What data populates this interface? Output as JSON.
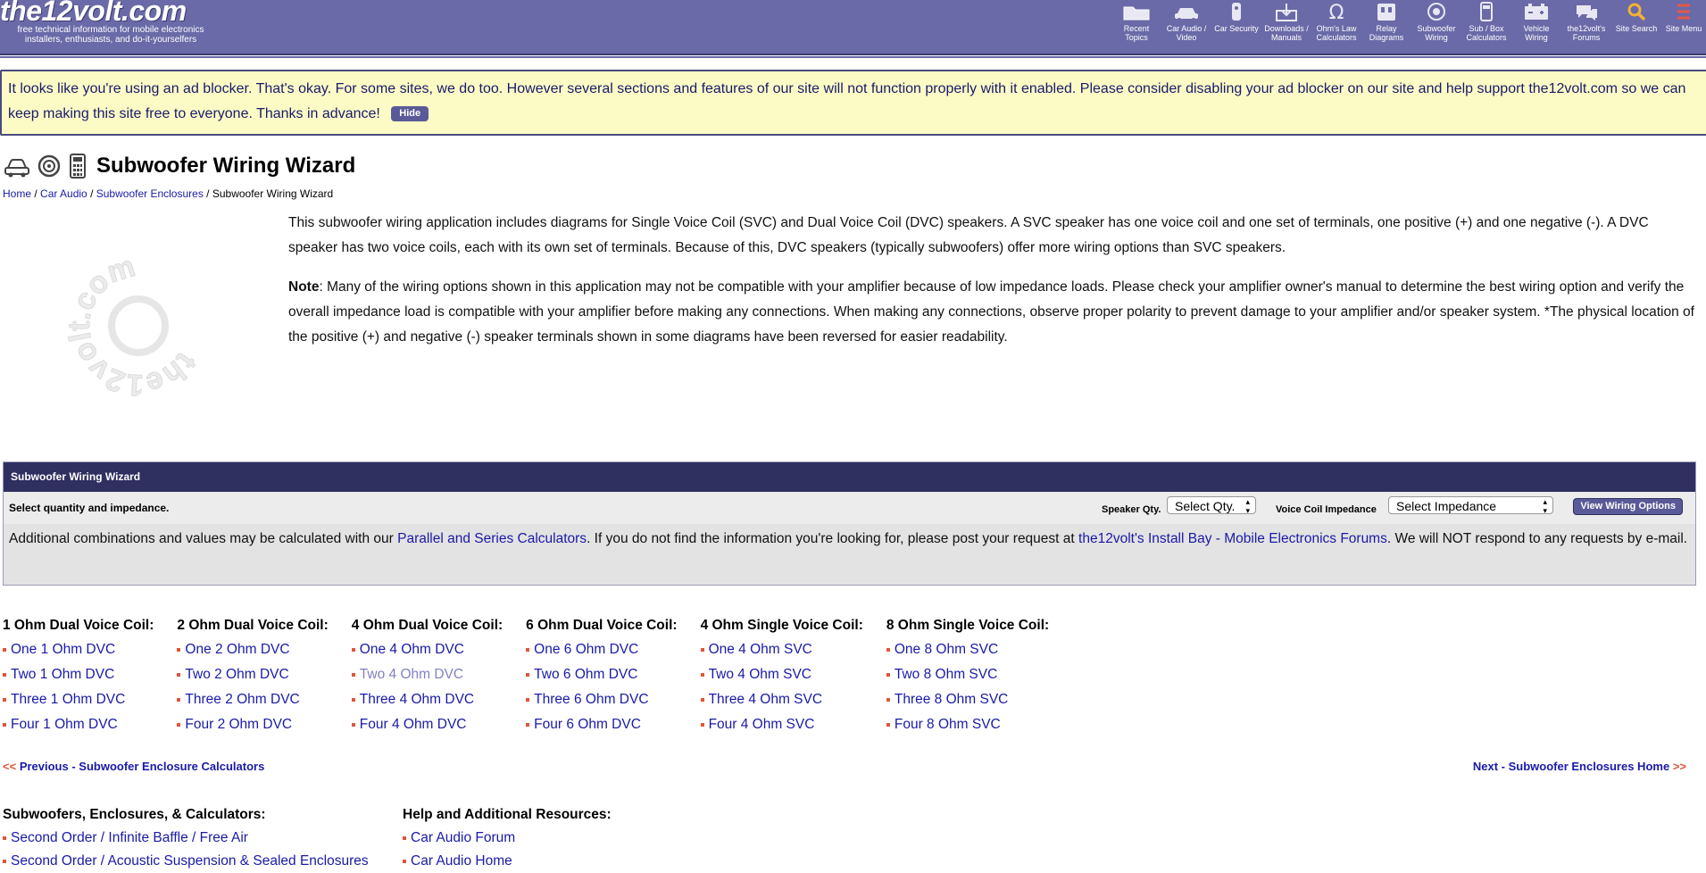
{
  "header": {
    "logo": "the12volt.com",
    "tagline": "free technical information for mobile electronics installers, enthusiasts, and do-it-yourselfers",
    "nav": [
      {
        "label": "Recent Topics",
        "icon": "folder-icon"
      },
      {
        "label": "Car Audio / Video",
        "icon": "car-icon"
      },
      {
        "label": "Car Security",
        "icon": "remote-icon"
      },
      {
        "label": "Downloads / Manuals",
        "icon": "download-icon"
      },
      {
        "label": "Ohm's Law Calculators",
        "icon": "omega-icon"
      },
      {
        "label": "Relay Diagrams",
        "icon": "relay-icon"
      },
      {
        "label": "Subwoofer Wiring",
        "icon": "speaker-icon"
      },
      {
        "label": "Sub / Box Calculators",
        "icon": "calculator-icon"
      },
      {
        "label": "Vehicle Wiring",
        "icon": "battery-icon"
      },
      {
        "label": "the12volt's Forums",
        "icon": "forum-icon"
      },
      {
        "label": "Site Search",
        "icon": "search-icon"
      },
      {
        "label": "Site Menu",
        "icon": "hamburger-icon"
      }
    ]
  },
  "notice": {
    "text": "It looks like you're using an ad blocker. That's okay. For some sites, we do too. However several sections and features of our site will not function properly with it enabled. Please consider disabling your ad blocker on our site and help support the12volt.com so we can keep making this site free to everyone. Thanks in advance!",
    "hide_label": "Hide"
  },
  "page": {
    "title": "Subwoofer Wiring Wizard",
    "breadcrumb": [
      {
        "label": "Home",
        "link": true
      },
      {
        "label": "Car Audio",
        "link": true
      },
      {
        "label": "Subwoofer Enclosures",
        "link": true
      },
      {
        "label": "Subwoofer Wiring Wizard",
        "link": false
      }
    ],
    "watermark_text": "the12volt.com",
    "intro_p1": "This subwoofer wiring application includes diagrams for Single Voice Coil (SVC) and Dual Voice Coil (DVC) speakers. A SVC speaker has one voice coil and one set of terminals, one positive (+) and one negative (-). A DVC speaker has two voice coils, each with its own set of terminals. Because of this, DVC speakers (typically subwoofers) offer more wiring options than SVC speakers.",
    "intro_note_label": "Note",
    "intro_p2": ": Many of the wiring options shown in this application may not be compatible with your amplifier because of low impedance loads. Please check your amplifier owner's manual to determine the best wiring option and verify the overall impedance load is compatible with your amplifier before making any connections. When making any connections, observe proper polarity to prevent damage to your amplifier and/or speaker system. *The physical location of the positive (+) and negative (-) speaker terminals shown in some diagrams have been reversed for easier readability."
  },
  "wizard": {
    "title": "Subwoofer Wiring Wizard",
    "prompt": "Select quantity and impedance.",
    "qty_label": "Speaker Qty.",
    "qty_value": "Select Qty.",
    "impedance_label": "Voice Coil Impedance",
    "impedance_value": "Select Impedance",
    "button_label": "View Wiring Options",
    "note_before": "Additional combinations and values may be calculated with our ",
    "note_link1": "Parallel and Series Calculators",
    "note_middle": ". If you do not find the information you're looking for, please post your request at ",
    "note_link2": "the12volt's Install Bay - Mobile Electronics Forums",
    "note_after": ". We will NOT respond to any requests by e-mail."
  },
  "coils": [
    {
      "heading": "1 Ohm Dual Voice Coil:",
      "items": [
        "One 1 Ohm DVC",
        "Two 1 Ohm DVC",
        "Three 1 Ohm DVC",
        "Four 1 Ohm DVC"
      ]
    },
    {
      "heading": "2 Ohm Dual Voice Coil:",
      "items": [
        "One 2 Ohm DVC",
        "Two 2 Ohm DVC",
        "Three 2 Ohm DVC",
        "Four 2 Ohm DVC"
      ]
    },
    {
      "heading": "4 Ohm Dual Voice Coil:",
      "items": [
        "One 4 Ohm DVC",
        "Two 4 Ohm DVC",
        "Three 4 Ohm DVC",
        "Four 4 Ohm DVC"
      ]
    },
    {
      "heading": "6 Ohm Dual Voice Coil:",
      "items": [
        "One 6 Ohm DVC",
        "Two 6 Ohm DVC",
        "Three 6 Ohm DVC",
        "Four 6 Ohm DVC"
      ]
    },
    {
      "heading": "4 Ohm Single Voice Coil:",
      "items": [
        "One 4 Ohm SVC",
        "Two 4 Ohm SVC",
        "Three 4 Ohm SVC",
        "Four 4 Ohm SVC"
      ]
    },
    {
      "heading": "8 Ohm Single Voice Coil:",
      "items": [
        "One 8 Ohm SVC",
        "Two 8 Ohm SVC",
        "Three 8 Ohm SVC",
        "Four 8 Ohm SVC"
      ]
    }
  ],
  "prevnext": {
    "prev_arrow": "<<",
    "prev_label": "Previous - Subwoofer Enclosure Calculators",
    "next_label": "Next - Subwoofer Enclosures Home",
    "next_arrow": ">>"
  },
  "resources": {
    "left_heading": "Subwoofers, Enclosures, & Calculators:",
    "left_items": [
      "Second Order / Infinite Baffle / Free Air",
      "Second Order / Acoustic Suspension & Sealed Enclosures"
    ],
    "right_heading": "Help and Additional Resources:",
    "right_items": [
      "Car Audio Forum",
      "Car Audio Home"
    ]
  },
  "colors": {
    "header_bg": "#6a6aa8",
    "wizard_header_bg": "#2f2f60",
    "notice_bg": "#fcfbc6",
    "link": "#1a1aa8",
    "bullet": "#e0563a"
  }
}
